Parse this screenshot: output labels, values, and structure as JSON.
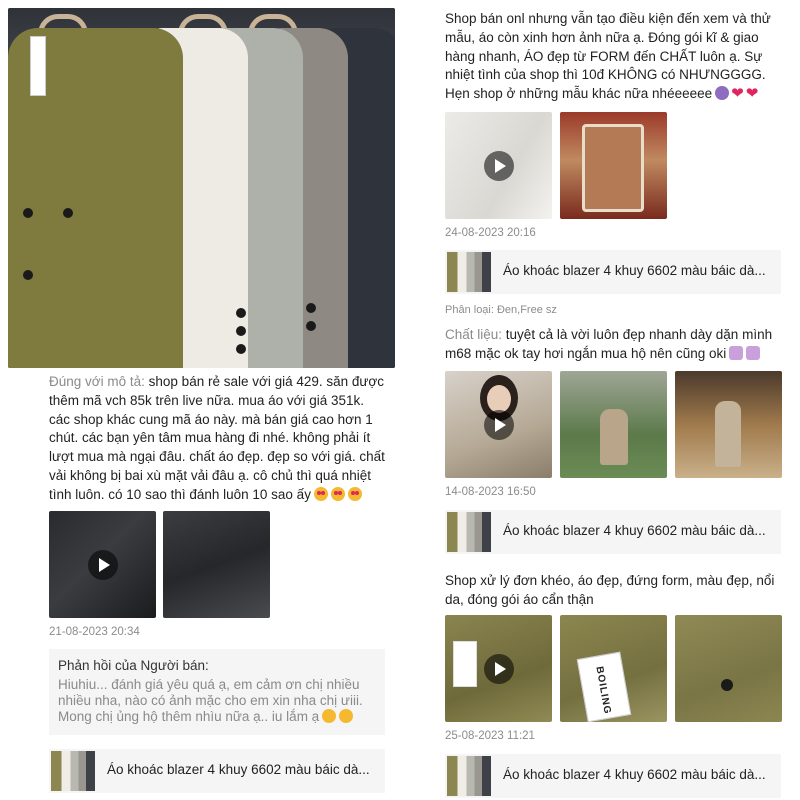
{
  "left_review": {
    "text_label": "Đúng với mô tả:",
    "text_lines": [
      " shop bán rẻ sale với giá 429. săn được",
      "thêm mã vch 85k trên live nữa. mua áo với giá 351k.",
      "các shop khác cung mã áo này. mà bán giá cao hơn 1",
      "chút. các bạn yên tâm mua hàng đi nhé. không phải ít",
      "lượt mua mà ngại đâu. chất áo đẹp. đẹp so với giá. chất",
      "vải không bị bai xù mặt vải đâu ạ. cô chủ thì quá nhiệt",
      "tình luôn. có 10 sao thì đánh luôn 10 sao ấy"
    ],
    "date": "21-08-2023 20:34",
    "seller_reply": {
      "heading": "Phản hồi của Người bán:",
      "lines": [
        "Hiuhiu... đánh giá yêu quá ạ, em cảm ơn chị nhiều",
        "nhiều nha, nào có ảnh mặc cho em xin nha chị ưiii.",
        "Mong chị ủng hộ thêm nhìu nữa ạ.. iu lắm ạ"
      ]
    },
    "product_name": "Áo khoác blazer 4 khuy 6602 màu báic dà..."
  },
  "right_reviews": [
    {
      "lines": [
        "Shop bán onl nhưng vẫn tạo điều kiện đến xem và thử",
        "mẫu, áo còn xinh hơn ảnh nữa ạ. Đóng gói kĩ & giao",
        "hàng nhanh, ÁO đẹp từ FORM đến CHẤT luôn ạ. Sự",
        "nhiệt tình của shop thì 10đ KHÔNG có NHƯNGGGG.",
        "Hẹn shop ở những mẫu khác nữa nhéeeeee"
      ],
      "date": "24-08-2023 20:16",
      "product_name": "Áo khoác blazer 4 khuy 6602 màu báic dà..."
    },
    {
      "classification": "Phân loại: Đen,Free sz",
      "label": "Chất liệu:",
      "lines": [
        " tuyệt cả là vời luôn đẹp nhanh dày dặn mình",
        "m68 mặc ok  tay hơi ngắn mua hộ nên cũng oki"
      ],
      "date": "14-08-2023 16:50",
      "product_name": "Áo khoác blazer 4 khuy 6602 màu báic dà..."
    },
    {
      "lines": [
        "Shop xử lý đơn khéo, áo đẹp, đứng form, màu đẹp, nổi",
        "da, đóng gói áo cẩn thận"
      ],
      "date": "25-08-2023 11:21",
      "tag_text": "BOILING",
      "product_name": "Áo khoác blazer 4 khuy 6602 màu báic dà..."
    }
  ]
}
